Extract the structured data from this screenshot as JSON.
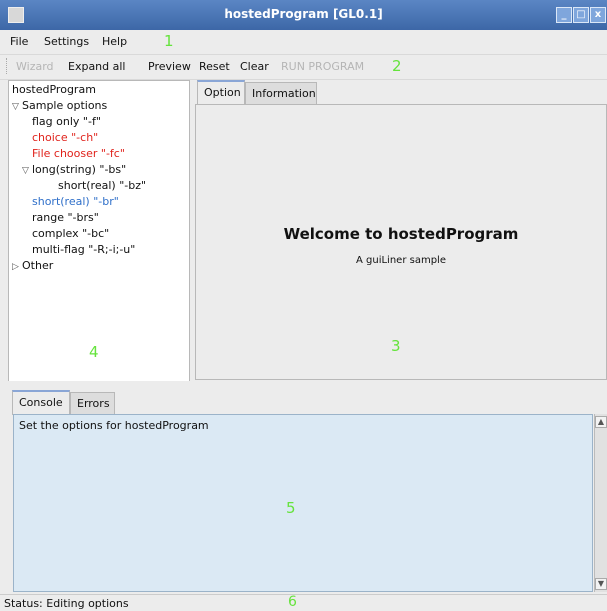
{
  "window": {
    "title": "hostedProgram [GL0.1]",
    "controls": [
      "_",
      "□",
      "x"
    ]
  },
  "menubar": {
    "items": [
      "File",
      "Settings",
      "Help"
    ]
  },
  "toolbar": {
    "items": [
      "Wizard",
      "Expand all",
      "Preview",
      "Reset",
      "Clear",
      "RUN PROGRAM"
    ],
    "disabled": [
      "Wizard",
      "RUN PROGRAM"
    ]
  },
  "tree": {
    "rows": [
      {
        "label": "hostedProgram",
        "twisty": "",
        "color": "#111111"
      },
      {
        "label": "Sample options",
        "twisty": "▽",
        "color": "#111111"
      },
      {
        "label": "flag only \"-f\"",
        "twisty": "",
        "color": "#111111"
      },
      {
        "label": "choice \"-ch\"",
        "twisty": "",
        "color": "#e0221b"
      },
      {
        "label": "File chooser \"-fc\"",
        "twisty": "",
        "color": "#e0221b"
      },
      {
        "label": "long(string) \"-bs\"",
        "twisty": "▽",
        "color": "#111111"
      },
      {
        "label": "short(real) \"-bz\"",
        "twisty": "",
        "color": "#111111"
      },
      {
        "label": "short(real) \"-br\"",
        "twisty": "",
        "color": "#2f6fc9"
      },
      {
        "label": "range \"-brs\"",
        "twisty": "",
        "color": "#111111"
      },
      {
        "label": "complex \"-bc\"",
        "twisty": "",
        "color": "#111111"
      },
      {
        "label": "multi-flag \"-R;-i;-u\"",
        "twisty": "",
        "color": "#111111"
      },
      {
        "label": "Other",
        "twisty": "▷",
        "color": "#111111"
      }
    ]
  },
  "main_tabs": {
    "items": [
      "Option",
      "Information"
    ],
    "active": "Option"
  },
  "main": {
    "welcome": "Welcome to hostedProgram",
    "subtitle": "A guiLiner sample"
  },
  "bottom_tabs": {
    "items": [
      "Console",
      "Errors"
    ],
    "active": "Console"
  },
  "console": {
    "text": "Set the options for hostedProgram"
  },
  "status": {
    "text": "Status: Editing options"
  },
  "callouts": [
    "1",
    "2",
    "3",
    "4",
    "5",
    "6"
  ],
  "colors": {
    "titlebar": "#4a75b8",
    "callout": "#65e33c",
    "console_bg": "#dbe9f4",
    "error_item": "#e0221b",
    "selected_item": "#2f6fc9"
  }
}
